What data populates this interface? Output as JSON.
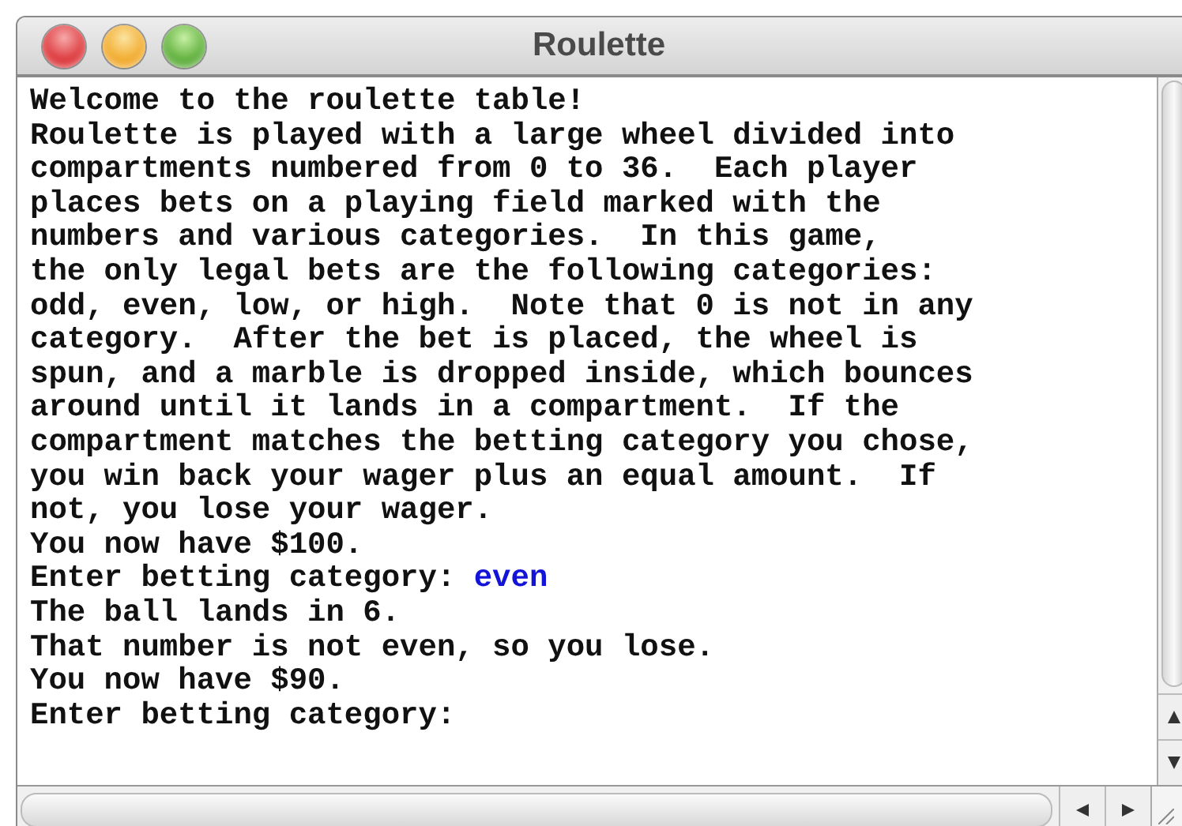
{
  "window": {
    "title": "Roulette"
  },
  "console": {
    "lines": [
      {
        "text": "Welcome to the roulette table!"
      },
      {
        "text": "Roulette is played with a large wheel divided into"
      },
      {
        "text": "compartments numbered from 0 to 36.  Each player"
      },
      {
        "text": "places bets on a playing field marked with the"
      },
      {
        "text": "numbers and various categories.  In this game,"
      },
      {
        "text": "the only legal bets are the following categories:"
      },
      {
        "text": "odd, even, low, or high.  Note that 0 is not in any"
      },
      {
        "text": "category.  After the bet is placed, the wheel is"
      },
      {
        "text": "spun, and a marble is dropped inside, which bounces"
      },
      {
        "text": "around until it lands in a compartment.  If the"
      },
      {
        "text": "compartment matches the betting category you chose,"
      },
      {
        "text": "you win back your wager plus an equal amount.  If"
      },
      {
        "text": "not, you lose your wager."
      },
      {
        "text": "You now have $100."
      },
      {
        "text": "Enter betting category: ",
        "input": "even"
      },
      {
        "text": "The ball lands in 6."
      },
      {
        "text": "That number is not even, so you lose."
      },
      {
        "text": "You now have $90."
      },
      {
        "text": "Enter betting category:"
      }
    ]
  }
}
